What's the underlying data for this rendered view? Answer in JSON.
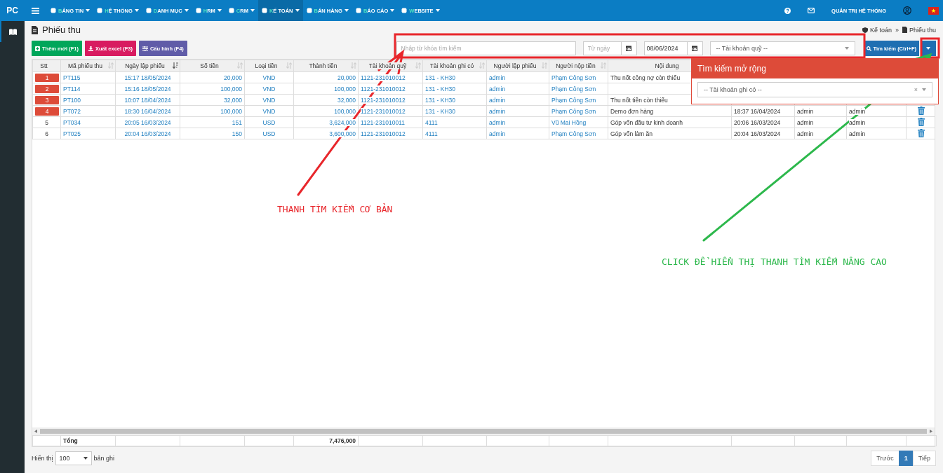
{
  "brand": "PC",
  "nav": [
    {
      "label": "BẢNG TIN",
      "selected": false
    },
    {
      "label": "HỆ THỐNG",
      "selected": false
    },
    {
      "label": "DANH MỤC",
      "selected": false
    },
    {
      "label": "HRM",
      "selected": false
    },
    {
      "label": "CRM",
      "selected": false
    },
    {
      "label": "KẾ TOÁN",
      "selected": true
    },
    {
      "label": "BÁN HÀNG",
      "selected": false
    },
    {
      "label": "BÁO CÁO",
      "selected": false
    },
    {
      "label": "WEBSITE",
      "selected": false
    }
  ],
  "user_menu": "QUẢN TRỊ HỆ THỐNG",
  "page_title": "Phiếu thu",
  "breadcrumb": [
    "Kế toán",
    "»",
    "Phiếu thu"
  ],
  "actions": [
    {
      "label": "Thêm mới (F1)",
      "kind": "add"
    },
    {
      "label": "Xuất excel (F3)",
      "kind": "export"
    },
    {
      "label": "Cấu hình (F4)",
      "kind": "config"
    }
  ],
  "filters": {
    "search_placeholder": "Nhập từ khóa tìm kiếm",
    "from_placeholder": "Từ ngày",
    "to_value": "08/06/2024",
    "fund_placeholder": "-- Tài khoản quỹ --",
    "search_button": "Tìm kiếm (Ctrl+F)"
  },
  "advanced_search": {
    "title": "Tìm kiếm mở rộng",
    "credit_placeholder": "-- Tài khoản ghi có --",
    "clear": "×"
  },
  "table": {
    "columns": [
      {
        "label": "Stt",
        "kind": "plain"
      },
      {
        "label": "Mã phiếu thu",
        "kind": "sortable"
      },
      {
        "label": "Ngày lập phiếu",
        "kind": "sorted"
      },
      {
        "label": "Số tiền",
        "kind": "sortable"
      },
      {
        "label": "Loại tiền",
        "kind": "sortable"
      },
      {
        "label": "Thành tiền",
        "kind": "sortable"
      },
      {
        "label": "Tài khoản quỹ",
        "kind": "sortable"
      },
      {
        "label": "Tài khoản ghi có",
        "kind": "sortable"
      },
      {
        "label": "Người lập phiếu",
        "kind": "sortable"
      },
      {
        "label": "Người nộp tiền",
        "kind": "sortable"
      },
      {
        "label": "Nội dung",
        "kind": "plain"
      }
    ],
    "rows": [
      {
        "flagged": true,
        "cells": [
          "1",
          "PT115",
          "15:17 18/05/2024",
          "20,000",
          "VND",
          "20,000",
          "1121-231010012",
          "131 - KH30",
          "admin",
          "Phạm Công Sơn",
          "Thu nốt công nợ còn thiếu"
        ]
      },
      {
        "flagged": true,
        "cells": [
          "2",
          "PT114",
          "15:16 18/05/2024",
          "100,000",
          "VND",
          "100,000",
          "1121-231010012",
          "131 - KH30",
          "admin",
          "Phạm Công Sơn",
          ""
        ]
      },
      {
        "flagged": true,
        "cells": [
          "3",
          "PT100",
          "10:07 18/04/2024",
          "32,000",
          "VND",
          "32,000",
          "1121-231010012",
          "131 - KH30",
          "admin",
          "Phạm Công Sơn",
          "Thu nốt tiền còn thiếu"
        ]
      },
      {
        "flagged": true,
        "cells": [
          "4",
          "PT072",
          "18:30 16/04/2024",
          "100,000",
          "VND",
          "100,000",
          "1121-231010012",
          "131 - KH30",
          "admin",
          "Phạm Công Sơn",
          "Demo đơn hàng"
        ],
        "extra": [
          "18:37 16/04/2024",
          "admin",
          "admin"
        ]
      },
      {
        "flagged": false,
        "cells": [
          "5",
          "PT034",
          "20:05 16/03/2024",
          "151",
          "USD",
          "3,624,000",
          "1121-231010011",
          "4111",
          "admin",
          "Vũ Mai Hồng",
          "Góp vốn đầu tư kinh doanh"
        ],
        "extra": [
          "20:06 16/03/2024",
          "admin",
          "admin"
        ]
      },
      {
        "flagged": false,
        "cells": [
          "6",
          "PT025",
          "20:04 16/03/2024",
          "150",
          "USD",
          "3,600,000",
          "1121-231010012",
          "4111",
          "admin",
          "Phạm Công Sơn",
          "Góp vốn làm ăn"
        ],
        "extra": [
          "20:04 16/03/2024",
          "admin",
          "admin"
        ]
      }
    ],
    "total_label": "Tổng",
    "total_value": "7,476,000"
  },
  "footer": {
    "show_label": "Hiển thị",
    "page_size": "100",
    "records_label": "bản ghi"
  },
  "pagination": [
    {
      "label": "Trước",
      "selected": false
    },
    {
      "label": "1",
      "selected": true
    },
    {
      "label": "Tiếp",
      "selected": false
    }
  ],
  "annotations": [
    {
      "text": "THANH TÌM KIẾM CƠ BẢN",
      "color": "#e8262b"
    },
    {
      "text": "CLICK ĐỂ HIỂN THỊ THANH TÌM KIẾM NÂNG CAO",
      "color": "#2db84c"
    }
  ]
}
